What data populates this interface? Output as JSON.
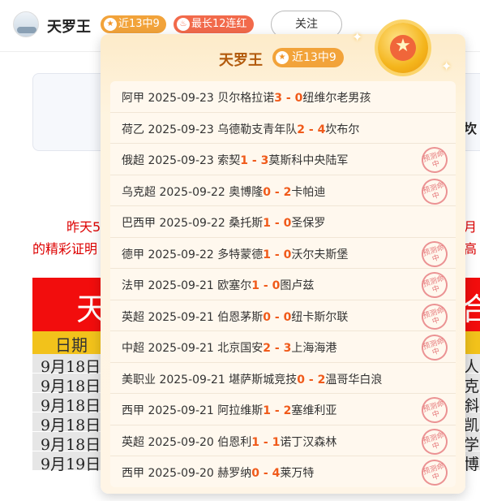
{
  "header": {
    "name": "天罗王",
    "badge_record": "近13中9",
    "badge_streak": "最长12连红",
    "follow_label": "关注"
  },
  "background": {
    "side_char": "坎",
    "line1_start": "昨天5",
    "line1_end": "月",
    "line2_start": "的精彩证明",
    "line2_end": "高",
    "band_left": "天",
    "band_right": "合",
    "col_header": "日期",
    "rows": [
      {
        "date": "9月18日",
        "tail": "人"
      },
      {
        "date": "9月18日",
        "tail": "克"
      },
      {
        "date": "9月18日",
        "tail": "斜"
      },
      {
        "date": "9月18日",
        "tail": "凯"
      },
      {
        "date": "9月18日",
        "tail": "学"
      },
      {
        "date": "9月19日",
        "tail": "博"
      }
    ]
  },
  "popup": {
    "title": "天罗王",
    "badge": "近13中9",
    "stamp_text": "预测命中",
    "matches": [
      {
        "league": "阿甲",
        "date": "2025-09-23",
        "home": "贝尔格拉诺",
        "hs": "3",
        "as": "0",
        "away": "纽维尔老男孩",
        "hit": false
      },
      {
        "league": "荷乙",
        "date": "2025-09-23",
        "home": "乌德勒支青年队",
        "hs": "2",
        "as": "4",
        "away": "坎布尔",
        "hit": false
      },
      {
        "league": "俄超",
        "date": "2025-09-23",
        "home": "索契",
        "hs": "1",
        "as": "3",
        "away": "莫斯科中央陆军",
        "hit": true
      },
      {
        "league": "乌克超",
        "date": "2025-09-22",
        "home": "奥博隆",
        "hs": "0",
        "as": "2",
        "away": "卡帕迪",
        "hit": true
      },
      {
        "league": "巴西甲",
        "date": "2025-09-22",
        "home": "桑托斯",
        "hs": "1",
        "as": "0",
        "away": "圣保罗",
        "hit": false
      },
      {
        "league": "德甲",
        "date": "2025-09-22",
        "home": "多特蒙德",
        "hs": "1",
        "as": "0",
        "away": "沃尔夫斯堡",
        "hit": true
      },
      {
        "league": "法甲",
        "date": "2025-09-21",
        "home": "欧塞尔",
        "hs": "1",
        "as": "0",
        "away": "图卢兹",
        "hit": true
      },
      {
        "league": "英超",
        "date": "2025-09-21",
        "home": "伯恩茅斯",
        "hs": "0",
        "as": "0",
        "away": "纽卡斯尔联",
        "hit": true
      },
      {
        "league": "中超",
        "date": "2025-09-21",
        "home": "北京国安",
        "hs": "2",
        "as": "3",
        "away": "上海海港",
        "hit": true
      },
      {
        "league": "美职业",
        "date": "2025-09-21",
        "home": "堪萨斯城竞技",
        "hs": "0",
        "as": "2",
        "away": "温哥华白浪",
        "hit": false
      },
      {
        "league": "西甲",
        "date": "2025-09-21",
        "home": "阿拉维斯",
        "hs": "1",
        "as": "2",
        "away": "塞维利亚",
        "hit": true
      },
      {
        "league": "英超",
        "date": "2025-09-20",
        "home": "伯恩利",
        "hs": "1",
        "as": "1",
        "away": "诺丁汉森林",
        "hit": true
      },
      {
        "league": "西甲",
        "date": "2025-09-20",
        "home": "赫罗纳",
        "hs": "0",
        "as": "4",
        "away": "莱万特",
        "hit": true
      }
    ]
  }
}
